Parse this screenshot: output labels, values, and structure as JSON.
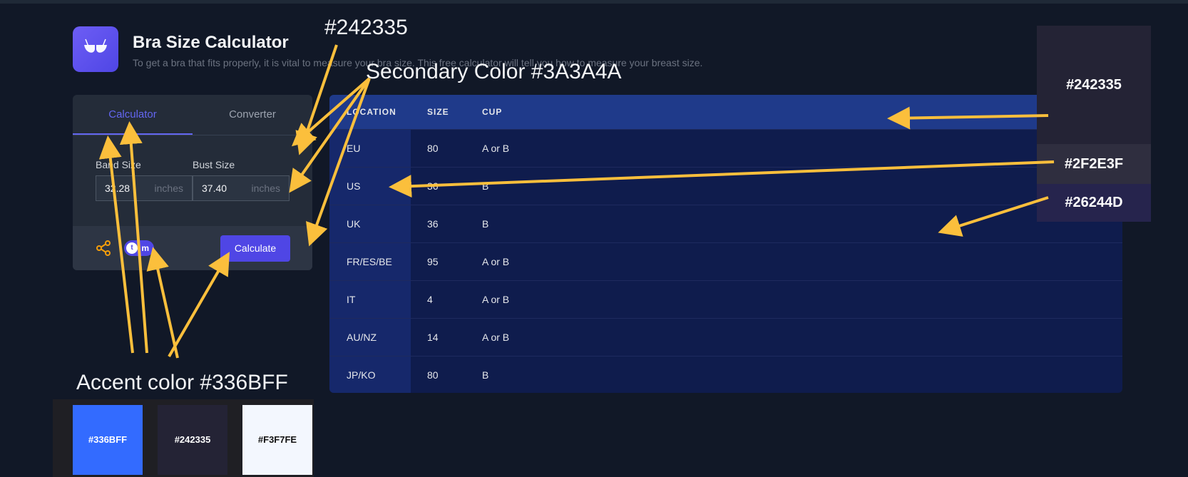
{
  "header": {
    "title": "Bra Size Calculator",
    "subtitle": "To get a bra that fits properly, it is vital to measure your bra size. This free calculator will tell you how to measure your breast size."
  },
  "tabs": [
    {
      "label": "Calculator",
      "active": true
    },
    {
      "label": "Converter",
      "active": false
    }
  ],
  "form": {
    "band": {
      "label": "Band Size",
      "value": "32.28",
      "unit": "inches"
    },
    "bust": {
      "label": "Bust Size",
      "value": "37.40",
      "unit": "inches"
    },
    "toggle": {
      "left": "t",
      "right": "m"
    },
    "calculate_label": "Calculate"
  },
  "table": {
    "headers": [
      "LOCATION",
      "SIZE",
      "CUP"
    ],
    "rows": [
      {
        "location": "EU",
        "size": "80",
        "cup": "A or B"
      },
      {
        "location": "US",
        "size": "36",
        "cup": "B"
      },
      {
        "location": "UK",
        "size": "36",
        "cup": "B"
      },
      {
        "location": "FR/ES/BE",
        "size": "95",
        "cup": "A or B"
      },
      {
        "location": "IT",
        "size": "4",
        "cup": "A or B"
      },
      {
        "location": "AU/NZ",
        "size": "14",
        "cup": "A or B"
      },
      {
        "location": "JP/KO",
        "size": "80",
        "cup": "B"
      }
    ]
  },
  "annotations": {
    "top_hex": "#242335",
    "secondary": "Secondary Color #3A3A4A",
    "accent": "Accent color  #336BFF",
    "right_swatches": [
      {
        "label": "#242335",
        "color": "#242335"
      },
      {
        "label": "#2F2E3F",
        "color": "#2F2E3F"
      },
      {
        "label": "#26244D",
        "color": "#26244D"
      }
    ],
    "bottom_swatches": [
      {
        "label": "#336BFF",
        "color": "#336BFF",
        "text": "#ffffff"
      },
      {
        "label": "#242335",
        "color": "#242335",
        "text": "#ffffff"
      },
      {
        "label": "#F3F7FE",
        "color": "#F3F7FE",
        "text": "#111111"
      }
    ]
  },
  "colors": {
    "accent": "#4f46e5",
    "arrow": "#FBBF3C",
    "share_icon": "#F59E0B"
  }
}
